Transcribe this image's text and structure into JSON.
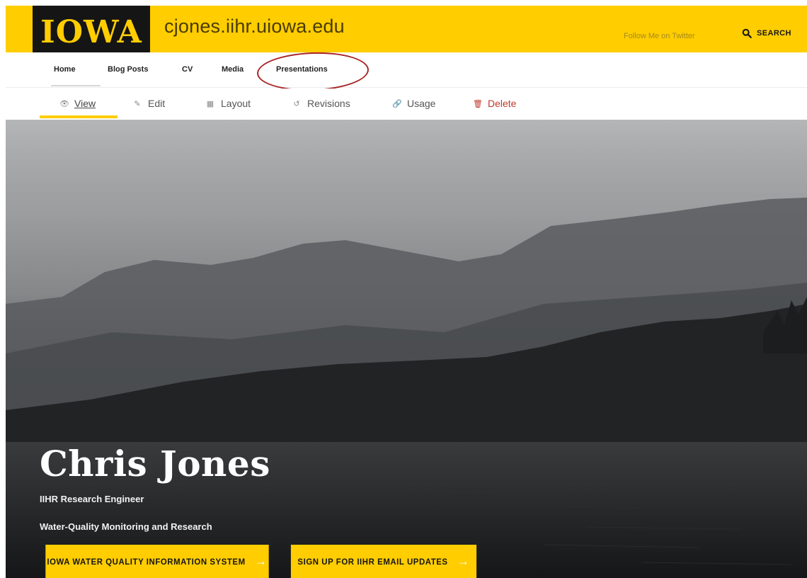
{
  "header": {
    "logo_text": "IOWA",
    "site_name": "cjones.iihr.uiowa.edu",
    "follow_link": "Follow Me on Twitter",
    "search_label": "SEARCH",
    "brand_color": "#ffcd00"
  },
  "main_nav": {
    "items": [
      {
        "label": "Home"
      },
      {
        "label": "Blog Posts"
      },
      {
        "label": "CV"
      },
      {
        "label": "Media"
      },
      {
        "label": "Presentations"
      }
    ]
  },
  "tasks": {
    "items": [
      {
        "label": "View",
        "icon": "eye-icon",
        "glyph": "👁"
      },
      {
        "label": "Edit",
        "icon": "edit-icon",
        "glyph": "✎"
      },
      {
        "label": "Layout",
        "icon": "layout-icon",
        "glyph": "▦"
      },
      {
        "label": "Revisions",
        "icon": "revisions-icon",
        "glyph": "↺"
      },
      {
        "label": "Usage",
        "icon": "link-icon",
        "glyph": "🔗"
      },
      {
        "label": "Delete",
        "icon": "trash-icon",
        "glyph": "🗑"
      }
    ],
    "active": "View"
  },
  "hero": {
    "title": "Chris Jones",
    "subtitle": "IIHR Research Engineer",
    "tagline": "Water-Quality Monitoring and Research",
    "buttons": [
      {
        "label": "IOWA WATER QUALITY INFORMATION SYSTEM",
        "arrow": "→"
      },
      {
        "label": "SIGN UP FOR IIHR EMAIL UPDATES",
        "arrow": "→"
      }
    ]
  }
}
